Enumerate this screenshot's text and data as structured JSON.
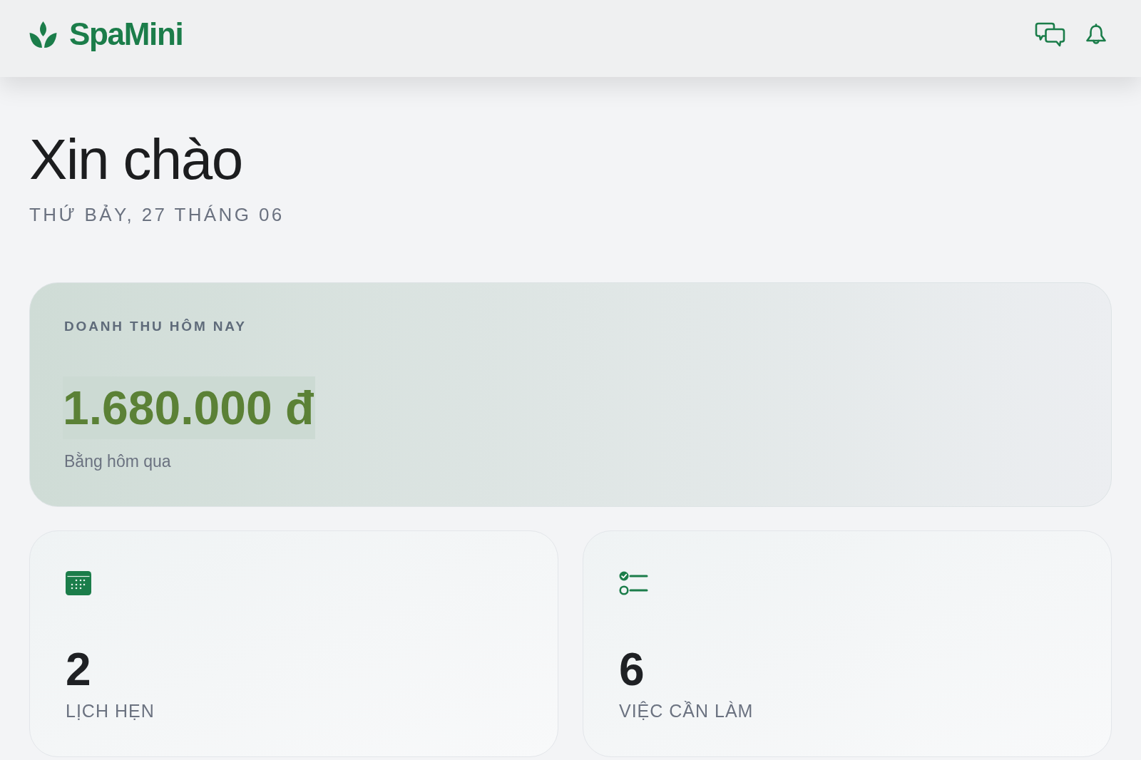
{
  "header": {
    "brand": "SpaMini"
  },
  "greeting": {
    "title": "Xin chào",
    "date": "THỨ BẢY, 27 THÁNG 06"
  },
  "revenue_card": {
    "label": "DOANH THU HÔM NAY",
    "amount": "1.680.000 đ",
    "comparison": "Bằng hôm qua"
  },
  "stat_cards": [
    {
      "kind": "appointments",
      "value": "2",
      "label": "LỊCH HẸN"
    },
    {
      "kind": "tasks",
      "value": "6",
      "label": "VIỆC CẦN LÀM"
    }
  ]
}
